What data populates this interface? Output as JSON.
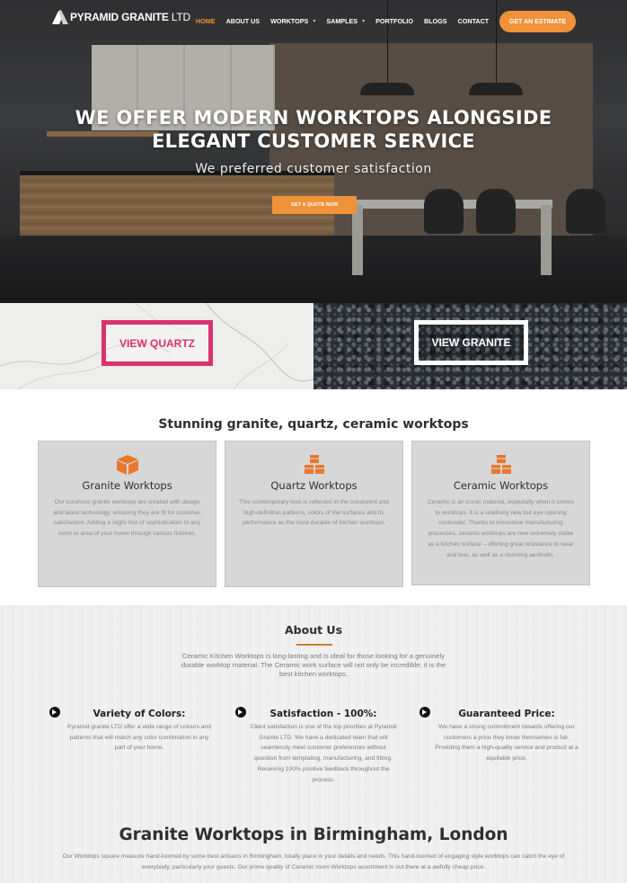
{
  "brand": {
    "name": "PYRAMID GRANITE",
    "suffix": "LTD",
    "accent_color": "#f0923a"
  },
  "nav": {
    "items": [
      {
        "label": "HOME",
        "active": true,
        "dropdown": false
      },
      {
        "label": "ABOUT US",
        "active": false,
        "dropdown": false
      },
      {
        "label": "WORKTOPS",
        "active": false,
        "dropdown": true
      },
      {
        "label": "SAMPLES",
        "active": false,
        "dropdown": true
      },
      {
        "label": "PORTFOLIO",
        "active": false,
        "dropdown": false
      },
      {
        "label": "BLOGS",
        "active": false,
        "dropdown": false
      },
      {
        "label": "CONTACT",
        "active": false,
        "dropdown": false
      }
    ],
    "cta_label": "GET AN ESTIMATE"
  },
  "hero": {
    "headline_line1": "WE OFFER MODERN WORKTOPS ALONGSIDE",
    "headline_line2": "ELEGANT CUSTOMER SERVICE",
    "subtitle": "We preferred customer satisfaction",
    "cta_label": "GET A QUOTE NOW"
  },
  "banners": {
    "quartz_label": "VIEW QUARTZ",
    "quartz_color": "#d8336f",
    "granite_label": "VIEW GRANITE"
  },
  "worktops": {
    "title": "Stunning granite, quartz, ceramic worktops",
    "cards": [
      {
        "icon": "cube-icon",
        "title": "Granite Worktops",
        "text": "Our luxurious granite worktops are created with design and latest technology, ensuring they are fit for customer satisfaction. Adding a slight hint of sophistication to any room or area of your home through various finishes."
      },
      {
        "icon": "cubes-icon",
        "title": "Quartz Worktops",
        "text": "This contemporary look is reflected in the consistent and high-definition patterns, colors of the surfaces and its performance as the most durable of kitchen worktops."
      },
      {
        "icon": "cubes-icon",
        "title": "Ceramic Worktops",
        "text": "Ceramic is an iconic material, especially when it comes to worktops. It is a relatively new but eye-opening contender. Thanks to innovative manufacturing processes, ceramic worktops are now extremely viable as a kitchen surface – offering great resistance to wear and tear, as well as a stunning aesthetic."
      }
    ]
  },
  "about": {
    "title": "About Us",
    "text": "Ceramic Kitchen Worktops is long-lasting and is ideal for those looking for a genuinely durable worktop material. The Ceramic work surface will not only be incredible; it is the best kitchen worktops.",
    "features": [
      {
        "icon": "arrow-circle-icon",
        "title": "Variety of Colors:",
        "text": "Pyramid granite LTD offer a wide range of colours and patterns that will match any color combination in any part of your home."
      },
      {
        "icon": "arrow-circle-icon",
        "title": "Satisfaction - 100%:",
        "text": "Client satisfaction is one of the top priorities at Pyramid Granite LTD. We have a dedicated team that will seamlessly meet customer preferences without question from templating, manufacturing, and fitting. Receiving 100% positive feedback throughout the process."
      },
      {
        "icon": "arrow-circle-icon",
        "title": "Guaranteed Price:",
        "text": "We have a strong commitment towards offering our customers a price they know themselves is fair. Providing them a high-quality service and product at a equitable price."
      }
    ]
  },
  "granite_section": {
    "title": "Granite Worktops in Birmingham, London",
    "text": "Our Worktops square measure hand-loomed by some best artisans in Birmingham, totally place in your details and needs. This hand-loomed of engaging style worktops can catch the eye of everybody, particularly your guests.  Our prime quality of Ceramic room Worktops assortment is out there at a awfully cheap price."
  }
}
